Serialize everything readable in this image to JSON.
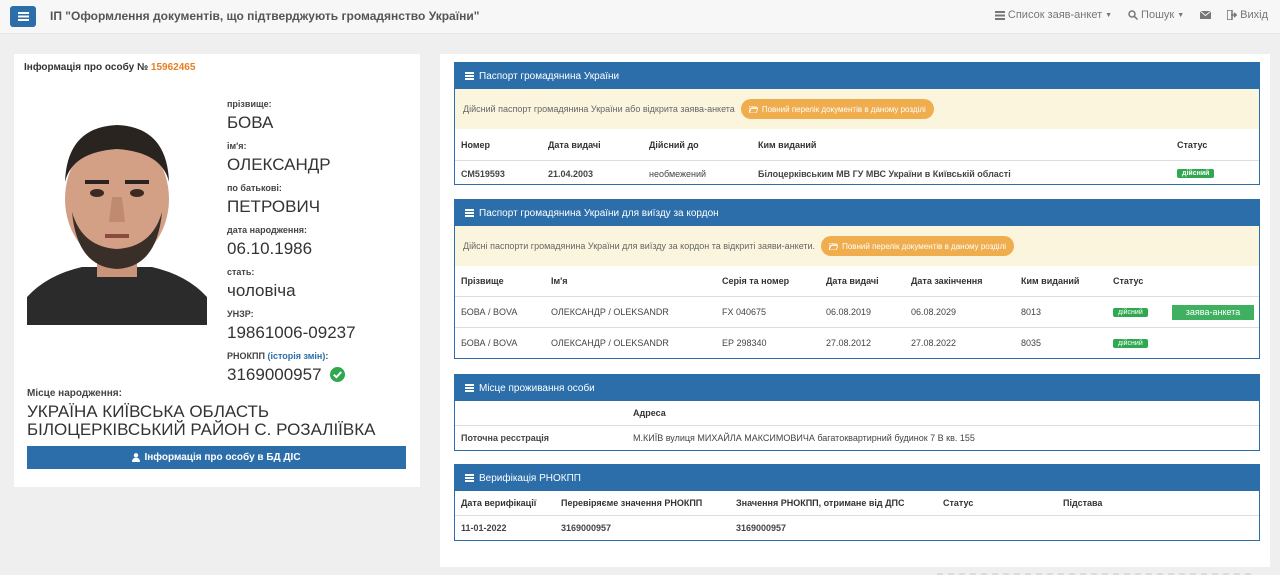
{
  "header": {
    "title": "ІП \"Оформлення документів, що підтверджують громадянство України\"",
    "nav": [
      {
        "label": "Список заяв-анкет",
        "icon": "list-icon",
        "dropdown": true
      },
      {
        "label": "Пошук",
        "icon": "search-icon",
        "dropdown": true
      },
      {
        "label": "",
        "icon": "envelope-icon",
        "dropdown": false
      },
      {
        "label": "Вихід",
        "icon": "logout-icon",
        "dropdown": false
      }
    ]
  },
  "person": {
    "heading_prefix": "Інформація про особу №",
    "number": "15962465",
    "fields": [
      {
        "label": "прізвище:",
        "value": "БОВА"
      },
      {
        "label": "ім'я:",
        "value": "ОЛЕКСАНДР"
      },
      {
        "label": "по батькові:",
        "value": "ПЕТРОВИЧ"
      },
      {
        "label": "дата народження:",
        "value": "06.10.1986"
      },
      {
        "label": "стать:",
        "value": "чоловіча"
      },
      {
        "label": "УНЗР:",
        "value": "19861006-09237"
      }
    ],
    "rnokpp_label": "РНОКПП",
    "rnokpp_link": "(історія змін)",
    "rnokpp_value": "3169000957",
    "birthplace_label": "Місце народження:",
    "birthplace_line1": "УКРАЇНА КИЇВСЬКА ОБЛАСТЬ",
    "birthplace_line2": "БІЛОЦЕРКІВСЬКИЙ РАЙОН С. РОЗАЛІЇВКА",
    "dis_button": "Інформація про особу в БД ДІС"
  },
  "passport": {
    "title": "Паспорт громадянина України",
    "notice": "Дійсний паспорт громадянина України або відкрита заява-анкета",
    "docs_button": "Повний перелік документів в даному розділі",
    "columns": [
      "Номер",
      "Дата видачі",
      "Дійсний до",
      "Ким виданий",
      "Статус"
    ],
    "rows": [
      [
        "СМ519593",
        "21.04.2003",
        "необмежений",
        "Білоцерківським МВ ГУ МВС України в Київській області",
        "дійсний"
      ]
    ]
  },
  "foreign_passport": {
    "title": "Паспорт громадянина України для виїзду за кордон",
    "notice": "Дійсні паспорти громадянина України для виїзду за кордон та відкриті заяви-анкети.",
    "docs_button": "Повний перелік документів в даному розділі",
    "columns": [
      "Прізвище",
      "Ім'я",
      "Серія та номер",
      "Дата видачі",
      "Дата закінчення",
      "Ким виданий",
      "Статус"
    ],
    "rows": [
      [
        "БОВА / BOVA",
        "ОЛЕКСАНДР / OLEKSANDR",
        "FX 040675",
        "06.08.2019",
        "06.08.2029",
        "8013",
        "дійсний"
      ],
      [
        "БОВА / BOVA",
        "ОЛЕКСАНДР / OLEKSANDR",
        "ЕР 298340",
        "27.08.2012",
        "27.08.2022",
        "8035",
        "дійсний"
      ]
    ],
    "row_action": "заява-анкета"
  },
  "residence": {
    "title": "Місце проживання особи",
    "address_header": "Адреса",
    "row_label": "Поточна ресстрація",
    "row_value": "М.КИЇВ вулиця МИХАЙЛА МАКСИМОВИЧА багатоквартирний будинок 7 В кв. 155"
  },
  "verification": {
    "title": "Верифікація РНОКПП",
    "columns": [
      "Дата верифікації",
      "Перевіряєме значення РНОКПП",
      "Значення РНОКПП, отримане від ДПС",
      "Статус",
      "Підстава"
    ],
    "row": [
      "11-01-2022",
      "3169000957",
      "3169000957",
      "",
      ""
    ]
  },
  "colors": {
    "primary": "#2b6ea9",
    "accent": "#e67e22",
    "success": "#2fa84f",
    "warning": "#f0ad4e",
    "notice_bg": "#fcf5de"
  }
}
